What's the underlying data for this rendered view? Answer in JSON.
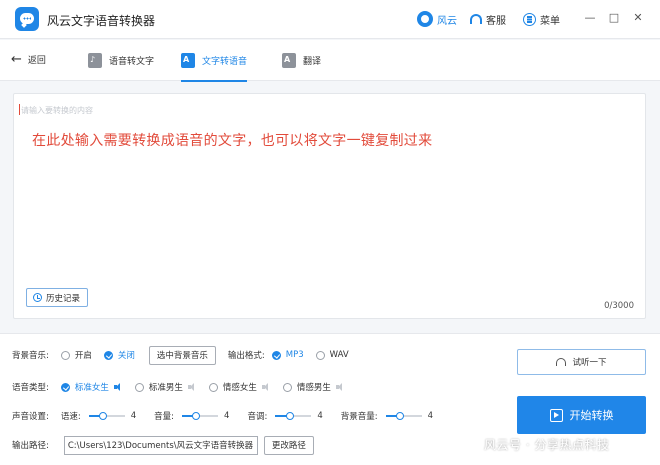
{
  "app": {
    "title": "风云文字语音转换器",
    "fengyun_label": "风云",
    "service_label": "客服",
    "menu_label": "菜单",
    "minimize_glyph": "—",
    "maximize_glyph": "□",
    "close_glyph": "✕"
  },
  "nav": {
    "back_label": "返回",
    "tabs": [
      {
        "label": "语音转文字",
        "icon": "speech-to-text-icon",
        "active": false
      },
      {
        "label": "文字转语音",
        "icon": "text-to-speech-icon",
        "active": true
      },
      {
        "label": "翻译",
        "icon": "translate-icon",
        "active": false
      }
    ]
  },
  "editor": {
    "placeholder": "请输入要转换的内容",
    "hint": "在此处输入需要转换成语音的文字，也可以将文字一键复制过来",
    "history_label": "历史记录",
    "counter": "0/3000"
  },
  "settings": {
    "bgm": {
      "label": "背景音乐:",
      "on_label": "开启",
      "off_label": "关闭",
      "selected": "关闭",
      "choose_button": "选中背景音乐"
    },
    "format": {
      "label": "输出格式:",
      "options": [
        "MP3",
        "WAV"
      ],
      "selected": "MP3"
    },
    "voice": {
      "label": "语音类型:",
      "options": [
        "标准女生",
        "标准男生",
        "情感女生",
        "情感男生"
      ],
      "selected": "标准女生"
    },
    "sound": {
      "label": "声音设置:",
      "speed_label": "语速:",
      "speed": 4,
      "volume_label": "音量:",
      "volume": 4,
      "pitch_label": "音调:",
      "pitch": 4,
      "bg_volume_label": "背景音量:",
      "bg_volume": 4
    },
    "output": {
      "label": "输出路径:",
      "path": "C:\\Users\\123\\Documents\\风云文字语音转换器",
      "change_button": "更改路径"
    },
    "preview_button": "试听一下",
    "convert_button": "开始转换"
  },
  "watermark": "风云号 · 分享热点科技",
  "colors": {
    "accent": "#1f86e6",
    "hint_red": "#e24b3b",
    "convert_bg": "#2086e8"
  }
}
